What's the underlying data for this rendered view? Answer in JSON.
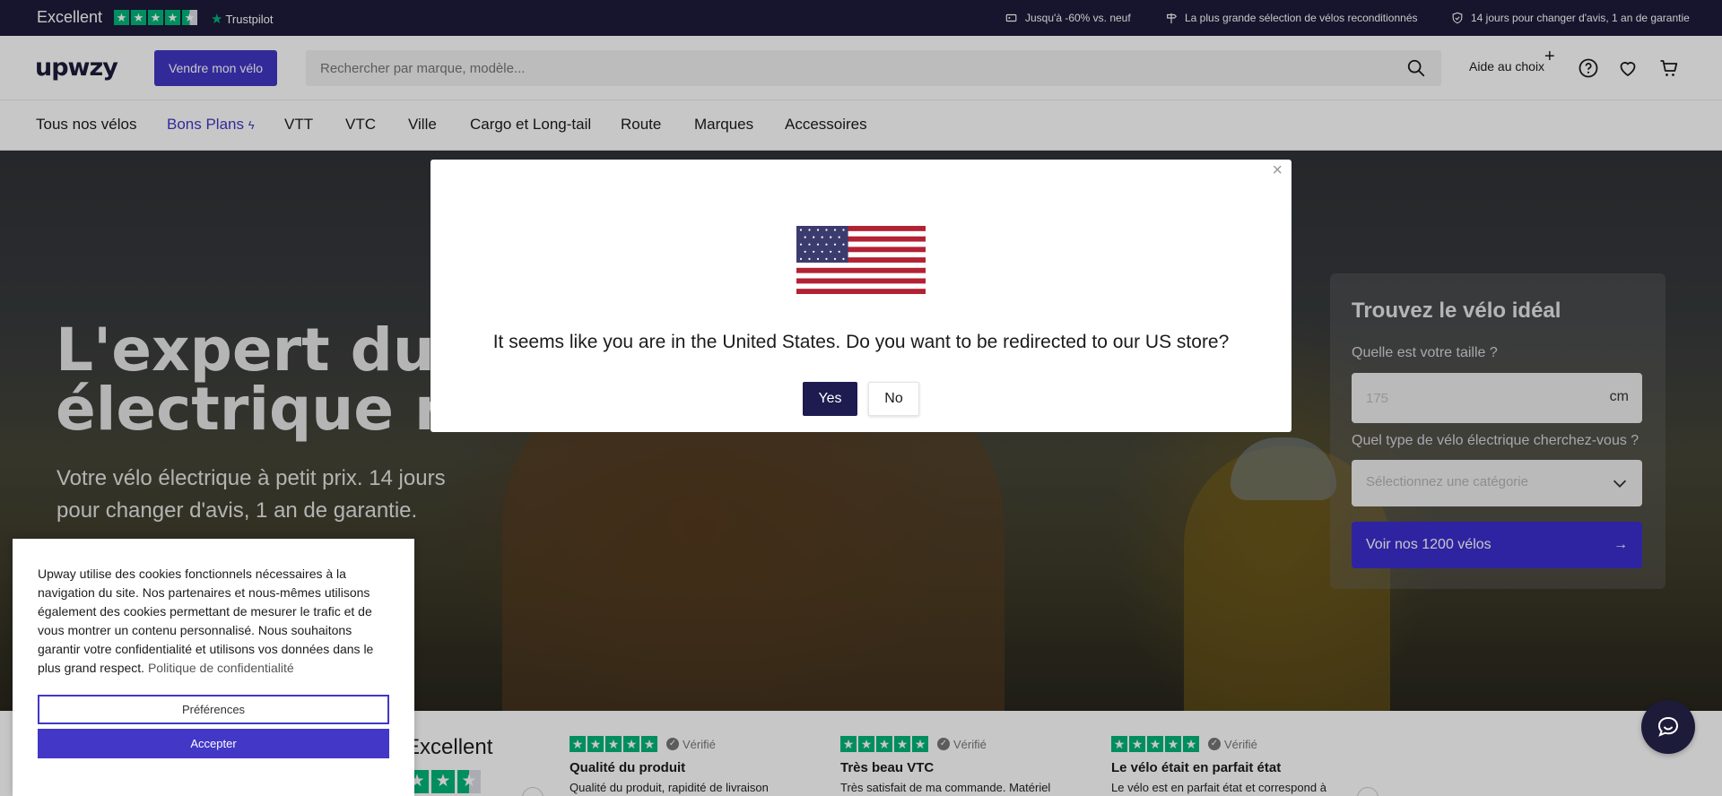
{
  "colors": {
    "brand_dark": "#1d1b3a",
    "accent": "#4237c6",
    "trustpilot_green": "#00b67a"
  },
  "topbar": {
    "trust_label": "Excellent",
    "trust_brand": "Trustpilot",
    "usp1": "Jusqu'à -60% vs. neuf",
    "usp2": "La plus grande sélection de vélos reconditionnés",
    "usp3": "14 jours pour changer d'avis, 1 an de garantie"
  },
  "header": {
    "logo": "upwzy",
    "sell_button": "Vendre mon vélo",
    "search_placeholder": "Rechercher par marque, modèle...",
    "help_link": "Aide au choix"
  },
  "nav": {
    "items": [
      "Tous nos vélos",
      "Bons Plans",
      "VTT",
      "VTC",
      "Ville",
      "Cargo et Long-tail",
      "Route",
      "Marques",
      "Accessoires"
    ]
  },
  "hero": {
    "title_line1": "L'expert du vé",
    "title_line2": "électrique rec",
    "subtitle": "Votre vélo électrique à petit prix. 14 jours pour changer d'avis, 1 an de garantie."
  },
  "finder": {
    "title": "Trouvez le vélo idéal",
    "size_label": "Quelle est votre taille ?",
    "size_placeholder": "175",
    "size_unit": "cm",
    "type_label": "Quel type de vélo électrique cherchez-vous ?",
    "type_placeholder": "Sélectionnez une catégorie",
    "cta": "Voir nos 1200 vélos"
  },
  "modal": {
    "message": "It seems like you are in the United States. Do you want to be redirected to our US store?",
    "yes": "Yes",
    "no": "No",
    "close": "×"
  },
  "cookie": {
    "text": "Upway utilise des cookies fonctionnels nécessaires à la navigation du site. Nos partenaires et nous-mêmes utilisons également des cookies permettant de mesurer le trafic et de vous montrer un contenu personnalisé. Nous souhaitons garantir votre confidentialité et utilisons vos données dans le plus grand respect.",
    "policy_link": "Politique de confidentialité",
    "preferences": "Préférences",
    "accept": "Accepter"
  },
  "reviews": {
    "summary": "Excellent",
    "verified_label": "Vérifié",
    "items": [
      {
        "title": "Qualité du produit",
        "body": "Qualité du produit, rapidité de livraison"
      },
      {
        "title": "Très beau VTC",
        "body": "Très satisfait de ma commande. Matériel"
      },
      {
        "title": "Le vélo était en parfait état",
        "body": "Le vélo est en parfait état et correspond à"
      }
    ]
  }
}
